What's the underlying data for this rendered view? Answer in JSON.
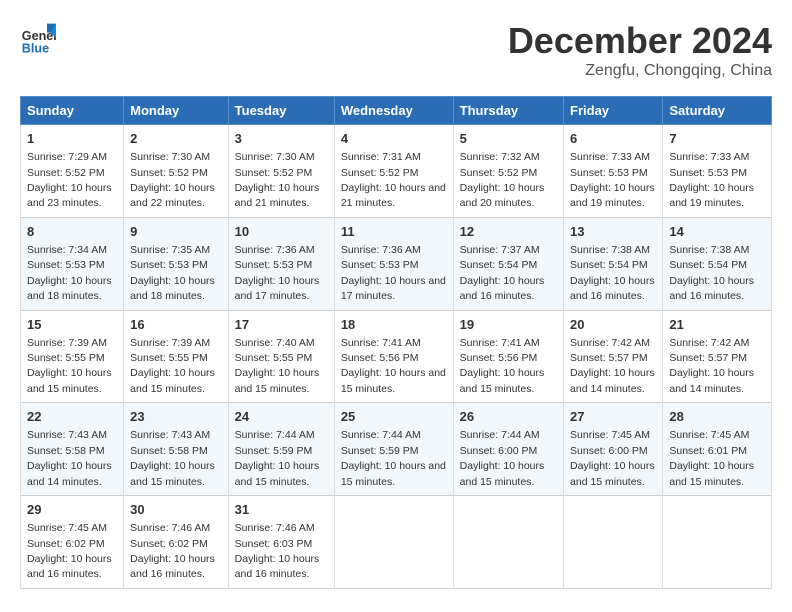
{
  "logo": {
    "line1": "General",
    "line2": "Blue"
  },
  "title": "December 2024",
  "location": "Zengfu, Chongqing, China",
  "days_of_week": [
    "Sunday",
    "Monday",
    "Tuesday",
    "Wednesday",
    "Thursday",
    "Friday",
    "Saturday"
  ],
  "weeks": [
    [
      {
        "day": "1",
        "sunrise": "Sunrise: 7:29 AM",
        "sunset": "Sunset: 5:52 PM",
        "daylight": "Daylight: 10 hours and 23 minutes."
      },
      {
        "day": "2",
        "sunrise": "Sunrise: 7:30 AM",
        "sunset": "Sunset: 5:52 PM",
        "daylight": "Daylight: 10 hours and 22 minutes."
      },
      {
        "day": "3",
        "sunrise": "Sunrise: 7:30 AM",
        "sunset": "Sunset: 5:52 PM",
        "daylight": "Daylight: 10 hours and 21 minutes."
      },
      {
        "day": "4",
        "sunrise": "Sunrise: 7:31 AM",
        "sunset": "Sunset: 5:52 PM",
        "daylight": "Daylight: 10 hours and 21 minutes."
      },
      {
        "day": "5",
        "sunrise": "Sunrise: 7:32 AM",
        "sunset": "Sunset: 5:52 PM",
        "daylight": "Daylight: 10 hours and 20 minutes."
      },
      {
        "day": "6",
        "sunrise": "Sunrise: 7:33 AM",
        "sunset": "Sunset: 5:53 PM",
        "daylight": "Daylight: 10 hours and 19 minutes."
      },
      {
        "day": "7",
        "sunrise": "Sunrise: 7:33 AM",
        "sunset": "Sunset: 5:53 PM",
        "daylight": "Daylight: 10 hours and 19 minutes."
      }
    ],
    [
      {
        "day": "8",
        "sunrise": "Sunrise: 7:34 AM",
        "sunset": "Sunset: 5:53 PM",
        "daylight": "Daylight: 10 hours and 18 minutes."
      },
      {
        "day": "9",
        "sunrise": "Sunrise: 7:35 AM",
        "sunset": "Sunset: 5:53 PM",
        "daylight": "Daylight: 10 hours and 18 minutes."
      },
      {
        "day": "10",
        "sunrise": "Sunrise: 7:36 AM",
        "sunset": "Sunset: 5:53 PM",
        "daylight": "Daylight: 10 hours and 17 minutes."
      },
      {
        "day": "11",
        "sunrise": "Sunrise: 7:36 AM",
        "sunset": "Sunset: 5:53 PM",
        "daylight": "Daylight: 10 hours and 17 minutes."
      },
      {
        "day": "12",
        "sunrise": "Sunrise: 7:37 AM",
        "sunset": "Sunset: 5:54 PM",
        "daylight": "Daylight: 10 hours and 16 minutes."
      },
      {
        "day": "13",
        "sunrise": "Sunrise: 7:38 AM",
        "sunset": "Sunset: 5:54 PM",
        "daylight": "Daylight: 10 hours and 16 minutes."
      },
      {
        "day": "14",
        "sunrise": "Sunrise: 7:38 AM",
        "sunset": "Sunset: 5:54 PM",
        "daylight": "Daylight: 10 hours and 16 minutes."
      }
    ],
    [
      {
        "day": "15",
        "sunrise": "Sunrise: 7:39 AM",
        "sunset": "Sunset: 5:55 PM",
        "daylight": "Daylight: 10 hours and 15 minutes."
      },
      {
        "day": "16",
        "sunrise": "Sunrise: 7:39 AM",
        "sunset": "Sunset: 5:55 PM",
        "daylight": "Daylight: 10 hours and 15 minutes."
      },
      {
        "day": "17",
        "sunrise": "Sunrise: 7:40 AM",
        "sunset": "Sunset: 5:55 PM",
        "daylight": "Daylight: 10 hours and 15 minutes."
      },
      {
        "day": "18",
        "sunrise": "Sunrise: 7:41 AM",
        "sunset": "Sunset: 5:56 PM",
        "daylight": "Daylight: 10 hours and 15 minutes."
      },
      {
        "day": "19",
        "sunrise": "Sunrise: 7:41 AM",
        "sunset": "Sunset: 5:56 PM",
        "daylight": "Daylight: 10 hours and 15 minutes."
      },
      {
        "day": "20",
        "sunrise": "Sunrise: 7:42 AM",
        "sunset": "Sunset: 5:57 PM",
        "daylight": "Daylight: 10 hours and 14 minutes."
      },
      {
        "day": "21",
        "sunrise": "Sunrise: 7:42 AM",
        "sunset": "Sunset: 5:57 PM",
        "daylight": "Daylight: 10 hours and 14 minutes."
      }
    ],
    [
      {
        "day": "22",
        "sunrise": "Sunrise: 7:43 AM",
        "sunset": "Sunset: 5:58 PM",
        "daylight": "Daylight: 10 hours and 14 minutes."
      },
      {
        "day": "23",
        "sunrise": "Sunrise: 7:43 AM",
        "sunset": "Sunset: 5:58 PM",
        "daylight": "Daylight: 10 hours and 15 minutes."
      },
      {
        "day": "24",
        "sunrise": "Sunrise: 7:44 AM",
        "sunset": "Sunset: 5:59 PM",
        "daylight": "Daylight: 10 hours and 15 minutes."
      },
      {
        "day": "25",
        "sunrise": "Sunrise: 7:44 AM",
        "sunset": "Sunset: 5:59 PM",
        "daylight": "Daylight: 10 hours and 15 minutes."
      },
      {
        "day": "26",
        "sunrise": "Sunrise: 7:44 AM",
        "sunset": "Sunset: 6:00 PM",
        "daylight": "Daylight: 10 hours and 15 minutes."
      },
      {
        "day": "27",
        "sunrise": "Sunrise: 7:45 AM",
        "sunset": "Sunset: 6:00 PM",
        "daylight": "Daylight: 10 hours and 15 minutes."
      },
      {
        "day": "28",
        "sunrise": "Sunrise: 7:45 AM",
        "sunset": "Sunset: 6:01 PM",
        "daylight": "Daylight: 10 hours and 15 minutes."
      }
    ],
    [
      {
        "day": "29",
        "sunrise": "Sunrise: 7:45 AM",
        "sunset": "Sunset: 6:02 PM",
        "daylight": "Daylight: 10 hours and 16 minutes."
      },
      {
        "day": "30",
        "sunrise": "Sunrise: 7:46 AM",
        "sunset": "Sunset: 6:02 PM",
        "daylight": "Daylight: 10 hours and 16 minutes."
      },
      {
        "day": "31",
        "sunrise": "Sunrise: 7:46 AM",
        "sunset": "Sunset: 6:03 PM",
        "daylight": "Daylight: 10 hours and 16 minutes."
      },
      null,
      null,
      null,
      null
    ]
  ]
}
